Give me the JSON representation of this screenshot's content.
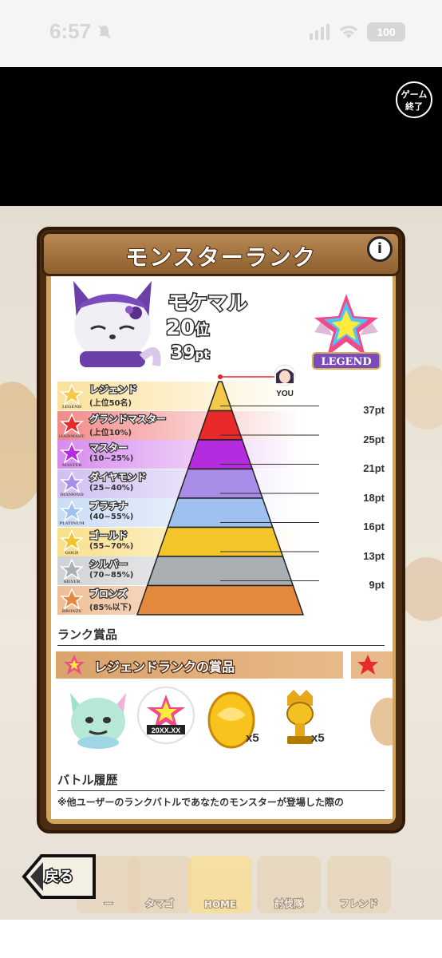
{
  "status_bar": {
    "time": "6:57",
    "battery": "100"
  },
  "game": {
    "exit_label_line1": "ゲーム",
    "exit_label_line2": "終了"
  },
  "dialog": {
    "title": "モンスターランク",
    "info_icon": "info-icon",
    "monster": {
      "name": "モケマル",
      "rank": "20",
      "rank_suffix": "位",
      "points": "39",
      "points_suffix": "pt"
    },
    "emblem_label": "LEGEND",
    "you_label": "YOU",
    "tiers": [
      {
        "name": "レジェンド",
        "range": "(上位50名)",
        "icon_label": "LEGEND",
        "color": "#f5c84a",
        "threshold": "37pt"
      },
      {
        "name": "グランドマスター",
        "range": "(上位10%)",
        "icon_label": "GRANDMASTER",
        "color": "#e82a2a",
        "threshold": "25pt"
      },
      {
        "name": "マスター",
        "range": "(10~25%)",
        "icon_label": "MASTER",
        "color": "#b52be0",
        "threshold": "21pt"
      },
      {
        "name": "ダイヤモンド",
        "range": "(25~40%)",
        "icon_label": "DIAMOND",
        "color": "#a98be8",
        "threshold": "18pt"
      },
      {
        "name": "プラチナ",
        "range": "(40~55%)",
        "icon_label": "PLATINUM",
        "color": "#9fc1ef",
        "threshold": "16pt"
      },
      {
        "name": "ゴールド",
        "range": "(55~70%)",
        "icon_label": "GOLD",
        "color": "#f4c52a",
        "threshold": "13pt"
      },
      {
        "name": "シルバー",
        "range": "(70~85%)",
        "icon_label": "SILVER",
        "color": "#a9afb3",
        "threshold": "9pt"
      },
      {
        "name": "ブロンズ",
        "range": "(85%以下)",
        "icon_label": "BRONZE",
        "color": "#e4883e",
        "threshold": ""
      }
    ],
    "rewards_section": "ランク賞品",
    "reward_banner": "レジェンドランクの賞品",
    "reward_items": [
      {
        "icon": "crystal-monster-icon",
        "qty": ""
      },
      {
        "icon": "legend-badge-icon",
        "qty": "",
        "label": "20XX.XX"
      },
      {
        "icon": "gold-egg-icon",
        "qty": "x5"
      },
      {
        "icon": "gold-trophy-icon",
        "qty": "x5"
      }
    ],
    "battle_section": "バトル履歴",
    "battle_note": "※他ユーザーのランクバトルであなたのモンスターが登場した際の"
  },
  "bottom_nav": {
    "back_label": "戻る",
    "items": [
      "ー",
      "タマゴ",
      "HOME",
      "討伐隊",
      "フレンド"
    ]
  }
}
